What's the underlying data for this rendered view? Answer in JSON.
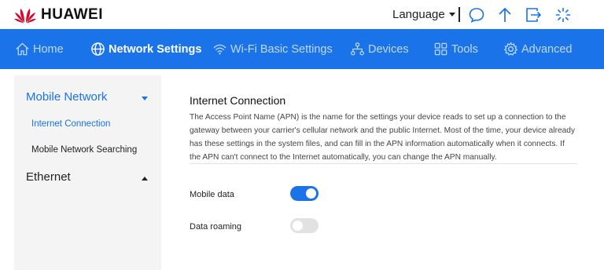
{
  "header": {
    "brand": "HUAWEI",
    "language_label": "Language",
    "icons": [
      "message-icon",
      "upload-icon",
      "logout-icon",
      "loading-icon"
    ]
  },
  "nav": {
    "items": [
      {
        "label": "Home",
        "icon": "home-icon",
        "active": false
      },
      {
        "label": "Network Settings",
        "icon": "globe-icon",
        "active": true
      },
      {
        "label": "Wi-Fi Basic Settings",
        "icon": "wifi-icon",
        "active": false
      },
      {
        "label": "Devices",
        "icon": "devices-icon",
        "active": false
      },
      {
        "label": "Tools",
        "icon": "tools-icon",
        "active": false
      },
      {
        "label": "Advanced",
        "icon": "gear-icon",
        "active": false
      }
    ]
  },
  "sidebar": {
    "groups": [
      {
        "label": "Mobile Network",
        "expanded": true,
        "items": [
          {
            "label": "Internet Connection",
            "selected": true
          },
          {
            "label": "Mobile Network Searching",
            "selected": false
          }
        ]
      },
      {
        "label": "Ethernet",
        "expanded": false,
        "items": []
      }
    ]
  },
  "main": {
    "title": "Internet Connection",
    "description": "The Access Point Name (APN) is the name for the settings your device reads to set up a connection to the gateway between your carrier's cellular network and the public Internet. Most of the time, your device already has these settings in the system files, and can fill in the APN information automatically when it connects. If the APN can't connect to the Internet automatically, you can change the APN manually.",
    "settings": [
      {
        "label": "Mobile data",
        "enabled": true
      },
      {
        "label": "Data roaming",
        "enabled": false
      }
    ]
  },
  "colors": {
    "accent": "#1a73e8",
    "logo_red": "#cf0a2c",
    "sidebar_bg": "#f4f4f4"
  }
}
